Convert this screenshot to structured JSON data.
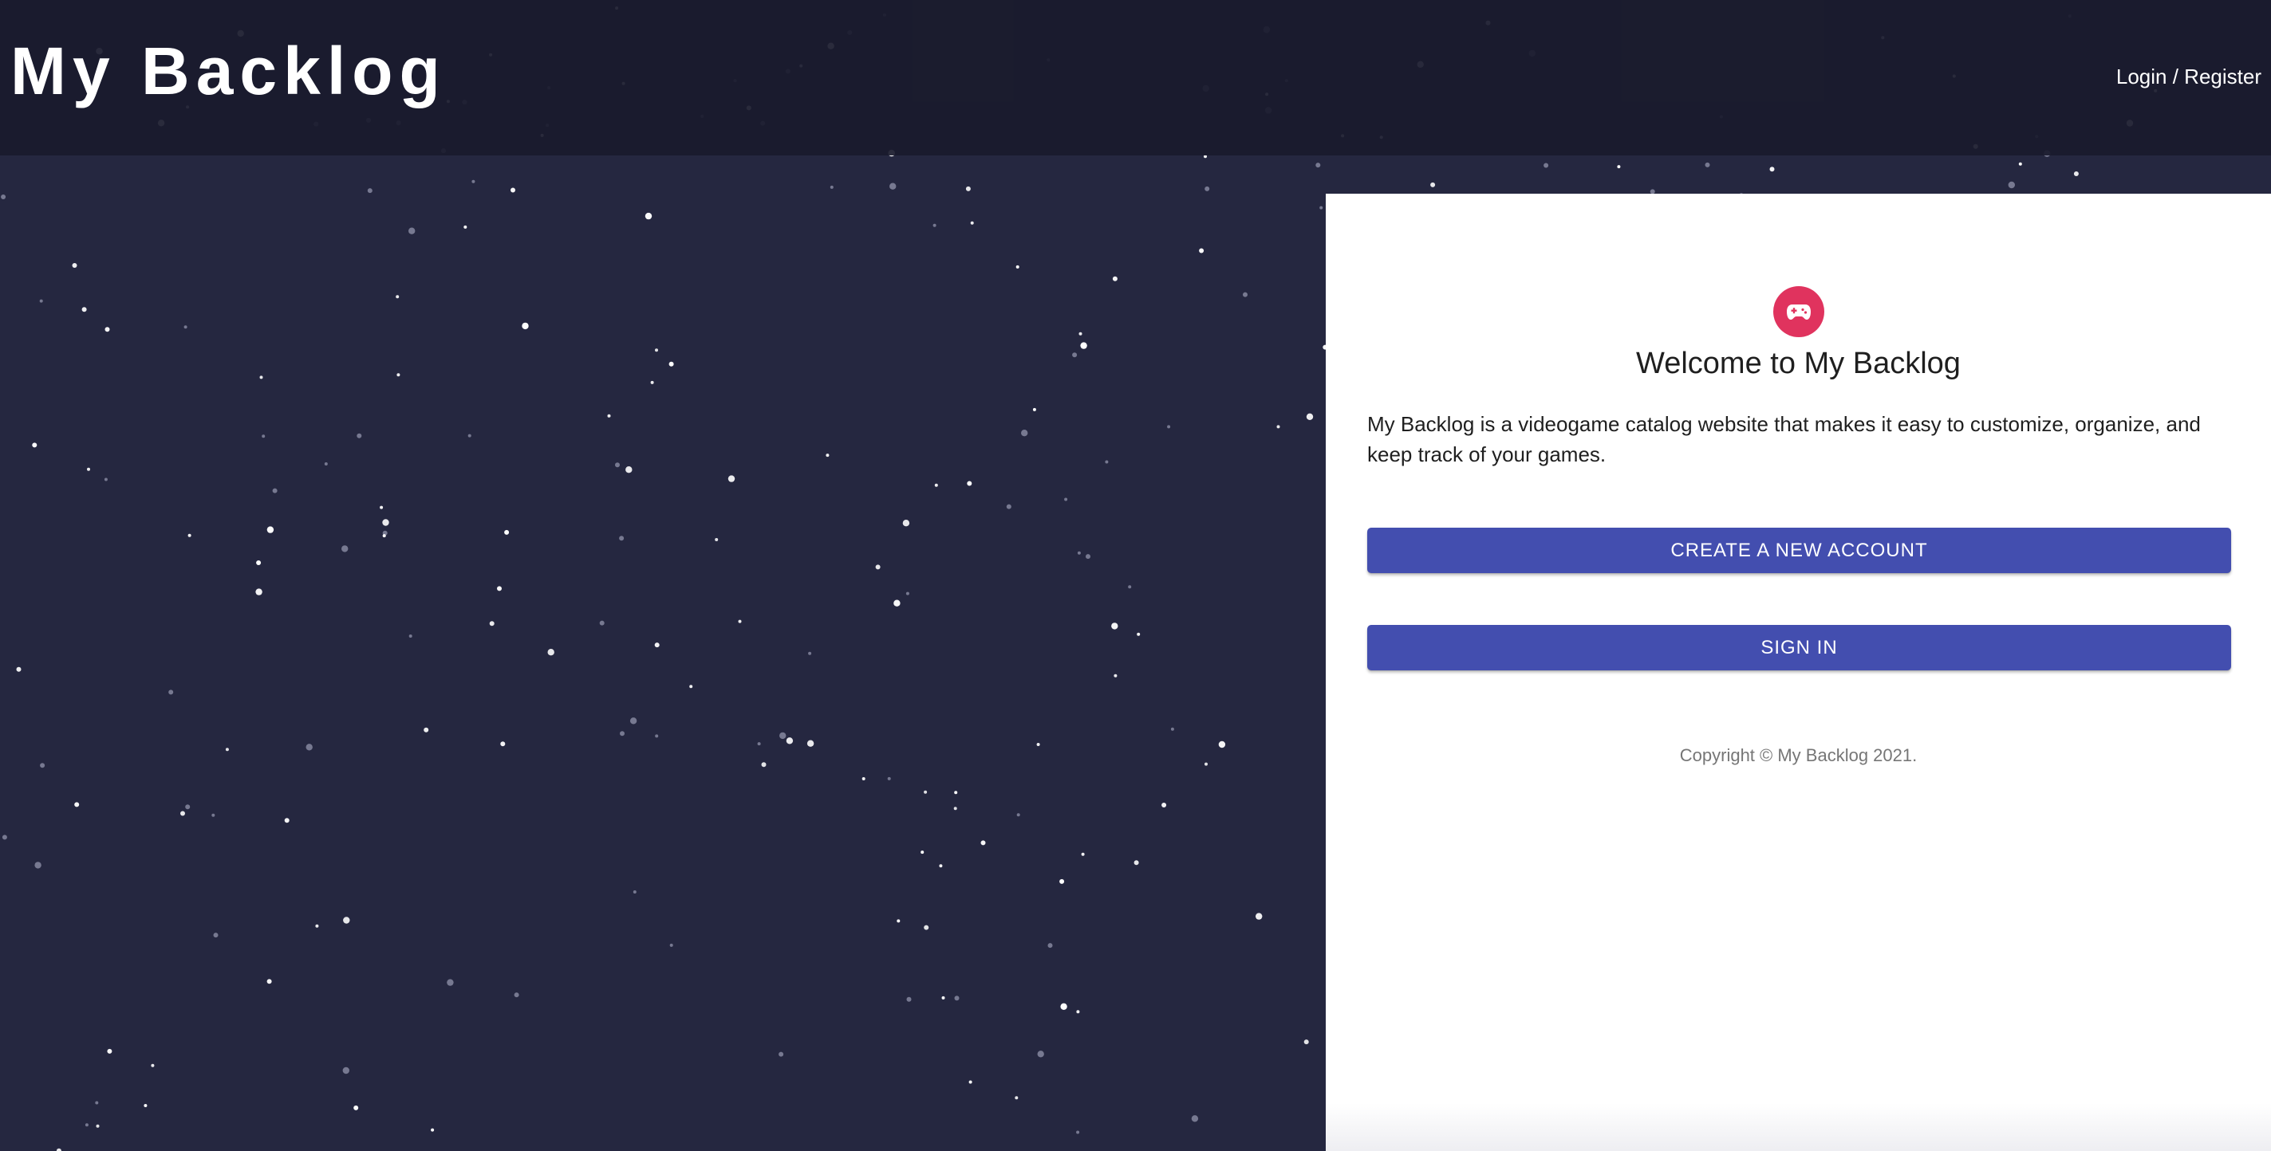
{
  "header": {
    "brand": "My Backlog",
    "auth_link": "Login / Register"
  },
  "welcome_panel": {
    "logo_icon": "gamepad-icon",
    "title": "Welcome to My Backlog",
    "description": "My Backlog is a videogame catalog website that makes it easy to customize, organize, and keep track of your games.",
    "create_account_label": "CREATE A NEW ACCOUNT",
    "sign_in_label": "SIGN IN",
    "copyright": "Copyright © My Backlog 2021."
  },
  "theme": {
    "background": "#252740",
    "header_background": "#1b1c2e",
    "accent_button": "#434eaf",
    "logo_badge": "#e0335e",
    "panel_background": "#ffffff"
  },
  "background_decoration": "starfield"
}
